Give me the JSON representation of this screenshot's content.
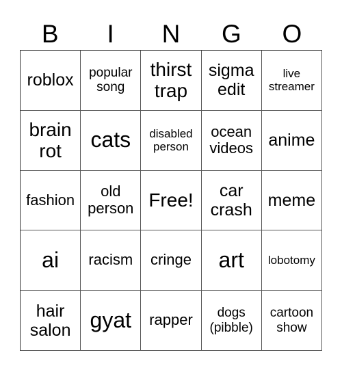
{
  "header": {
    "letters": [
      "B",
      "I",
      "N",
      "G",
      "O"
    ]
  },
  "cells": [
    [
      "roblox",
      "popular song",
      "thirst trap",
      "sigma edit",
      "live streamer"
    ],
    [
      "brain rot",
      "cats",
      "disabled person",
      "ocean videos",
      "anime"
    ],
    [
      "fashion",
      "old person",
      "Free!",
      "car crash",
      "meme"
    ],
    [
      "ai",
      "racism",
      "cringe",
      "art",
      "lobotomy"
    ],
    [
      "hair salon",
      "gyat",
      "rapper",
      "dogs (pibble)",
      "cartoon show"
    ]
  ]
}
